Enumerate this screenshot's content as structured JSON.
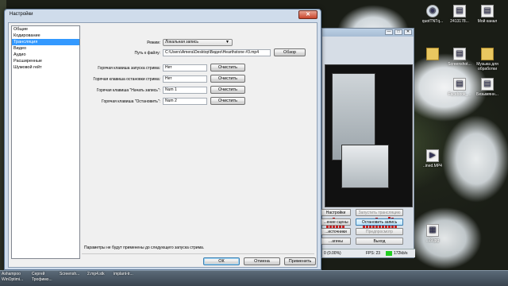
{
  "settings_dialog": {
    "title": "Настройки",
    "nav_items": [
      "Общие",
      "Кодирование",
      "Трансляция",
      "Видео",
      "Аудио",
      "Расширенные",
      "Шумовой гейт"
    ],
    "selected_index": 2,
    "mode_label": "Режим:",
    "mode_value": "Локальная запись",
    "file_path_label": "Путь к файлу:",
    "file_path_value": "C:\\Users\\Amera\\Desktop\\Видео\\Hearthstone #3.mp4",
    "browse_button": "Обзор",
    "hotkeys": [
      {
        "label": "Горячая клавиша запуска стрима:",
        "value": "Нет",
        "clear": "Очистить"
      },
      {
        "label": "Горячая клавиша остановки стрима:",
        "value": "Нет",
        "clear": "Очистить"
      },
      {
        "label": "Горячая клавиша \"Начать запись\":",
        "value": "Num 1",
        "clear": "Очистить"
      },
      {
        "label": "Горячая клавиша \"Остановить\":",
        "value": "Num 2",
        "clear": "Очистить"
      }
    ],
    "note": "Параметры не будут применены до следующего запуска стрима.",
    "ok_button": "ОК",
    "cancel_button": "Отмена",
    "apply_button": "Применить"
  },
  "obs_window": {
    "buttons": [
      "Настройки",
      "Запустить трансляцию",
      "...ение сцены",
      "Остановить запись",
      "...источники",
      "Предпросмотр",
      "...агины",
      "Выход"
    ],
    "status_left": "0 (0.00%)",
    "fps": "FPS: 23",
    "bitrate": "172kb/s",
    "colors": {
      "status_ok": "#22cc22",
      "meter": "#c62020"
    }
  },
  "desktop": {
    "icons": [
      {
        "label": "quotTNTq...",
        "glyph": "document-icon"
      },
      {
        "label": "2413178...",
        "glyph": "document-icon"
      },
      {
        "label": "Мой канал",
        "glyph": "document-icon"
      },
      {
        "label": "",
        "glyph": "folder-icon"
      },
      {
        "label": "Screenshot...",
        "glyph": "document-icon"
      },
      {
        "label": "Музыка для обработки",
        "glyph": "folder-icon"
      },
      {
        "label": "Facebook_...",
        "glyph": "document-icon"
      },
      {
        "label": "Безымянн...",
        "glyph": "document-icon"
      },
      {
        "label": "..ined.MP4",
        "glyph": "video-icon"
      },
      {
        "label": "..19.jpg",
        "glyph": "image-icon"
      }
    ],
    "taskbar_items": [
      {
        "line1": "Ashampoo",
        "line2": "WinOptimi..."
      },
      {
        "line1": "Сергей",
        "line2": "Трофимо..."
      },
      {
        "line1": "Screensh...",
        "line2": ""
      },
      {
        "line1": "2.mp4.stk",
        "line2": ""
      },
      {
        "line1": "implant-tr...",
        "line2": ""
      }
    ]
  }
}
